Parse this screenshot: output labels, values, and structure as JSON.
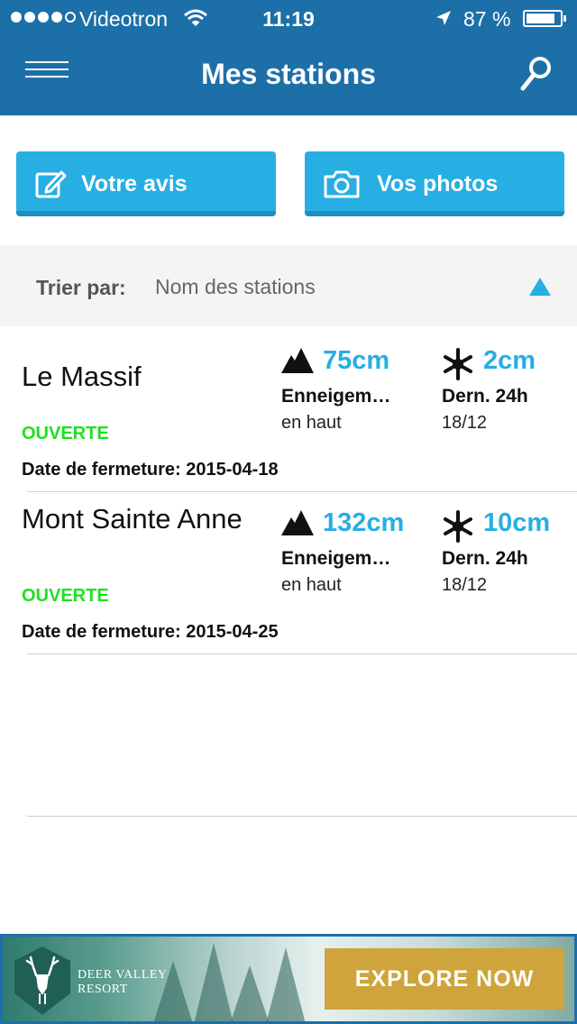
{
  "status_bar": {
    "carrier": "Videotron",
    "time": "11:19",
    "battery_percent": "87 %",
    "battery_level": 0.87
  },
  "nav": {
    "title": "Mes stations",
    "menu_icon": "hamburger-menu-icon",
    "search_icon": "search-icon"
  },
  "actions": {
    "review_label": "Votre avis",
    "review_icon": "edit-icon",
    "photos_label": "Vos photos",
    "photos_icon": "camera-icon"
  },
  "sort": {
    "label": "Trier par:",
    "value": "Nom des stations",
    "arrow_icon": "triangle-up-icon"
  },
  "stations": [
    {
      "name": "Le Massif",
      "status": "OUVERTE",
      "closing": "Date de fermeture: 2015-04-18",
      "base_value": "75cm",
      "base_label": "Enneigem…",
      "base_sub": "en haut",
      "snow_value": "2cm",
      "snow_label": "Dern. 24h",
      "snow_sub": "18/12"
    },
    {
      "name": "Mont Sainte Anne",
      "status": "OUVERTE",
      "closing": "Date de fermeture: 2015-04-25",
      "base_value": "132cm",
      "base_label": "Enneigem…",
      "base_sub": "en haut",
      "snow_value": "10cm",
      "snow_label": "Dern. 24h",
      "snow_sub": "18/12"
    }
  ],
  "ad": {
    "brand_line1": "DEER VALLEY",
    "brand_line2": "RESORT",
    "cta": "EXPLORE NOW"
  },
  "colors": {
    "nav_bg": "#1d6fa8",
    "accent": "#27aee3",
    "open_status": "#1ee01e",
    "ad_cta": "#cfa43c"
  }
}
